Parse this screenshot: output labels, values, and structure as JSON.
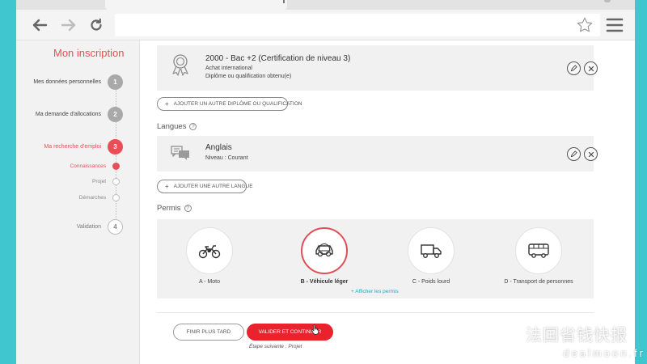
{
  "browser": {
    "tab_mark": "|",
    "icons": {
      "back": "arrow-left-icon",
      "forward": "arrow-right-icon",
      "reload": "reload-icon",
      "bookmark": "star-icon",
      "menu": "hamburger-menu-icon"
    }
  },
  "sidebar": {
    "title": "Mon inscription",
    "steps": [
      {
        "num": "1",
        "label": "Mes données personnelles",
        "state": "done"
      },
      {
        "num": "2",
        "label": "Ma demande d'allocations",
        "state": "done"
      },
      {
        "num": "3",
        "label": "Ma recherche d'emploi",
        "state": "active"
      },
      {
        "num": "4",
        "label": "Validation",
        "state": "pending"
      }
    ],
    "substeps": [
      {
        "label": "Connaissances",
        "state": "active"
      },
      {
        "label": "Projet",
        "state": "pending"
      },
      {
        "label": "Démarches",
        "state": "pending"
      }
    ]
  },
  "diplomes": {
    "card": {
      "title": "2000 - Bac +2 (Certification de niveau 3)",
      "line1": "Achat international",
      "line2": "Diplôme ou qualification obtenu(e)",
      "icon": "award-ribbon-icon"
    },
    "add_label": "AJOUTER UN AUTRE DIPLÔME OU QUALIFICATION"
  },
  "langues": {
    "heading": "Langues",
    "help": "?",
    "card": {
      "title": "Anglais",
      "level": "Niveau : Courant",
      "icon": "speech-bubbles-icon"
    },
    "add_label": "AJOUTER UNE AUTRE LANGUE"
  },
  "permis": {
    "heading": "Permis",
    "help": "?",
    "options": [
      {
        "label": "A - Moto",
        "icon": "motorcycle-icon",
        "selected": false
      },
      {
        "label": "B - Véhicule léger",
        "icon": "car-icon",
        "selected": true
      },
      {
        "label": "C - Poids lourd",
        "icon": "truck-icon",
        "selected": false
      },
      {
        "label": "D - Transport de personnes",
        "icon": "bus-icon",
        "selected": false
      }
    ],
    "link_label": "+ Afficher les permis"
  },
  "actions": {
    "finish_later": "FINIR PLUS TARD",
    "validate": "VALIDER ET CONTINUER",
    "next_step": "Étape suivante : Projet"
  },
  "watermark": {
    "cn": "法国省钱快报",
    "en": "dealmoon.fr"
  },
  "colors": {
    "accent": "#ea4d56",
    "primary_button": "#e8232e",
    "link": "#23a8c8",
    "background": "#3fc6cf"
  }
}
